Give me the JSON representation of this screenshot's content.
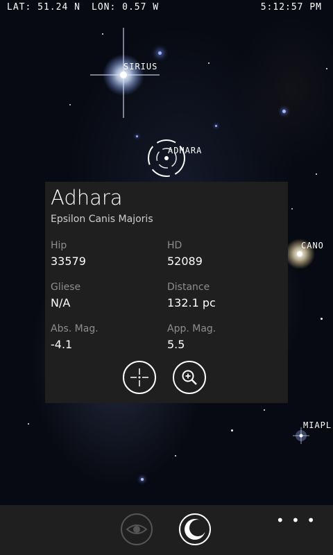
{
  "status": {
    "lat": "Lat: 51.24 N",
    "lon": "Lon: 0.57 W",
    "time": "5:12:57 PM"
  },
  "sky_labels": {
    "sirius": "Sirius",
    "adhara": "Adhara",
    "canopus": "Cano",
    "miaplacidus": "Miapl"
  },
  "card": {
    "name": "Adhara",
    "designation": "Epsilon Canis Majoris",
    "fields": [
      {
        "label": "Hip",
        "value": "33579"
      },
      {
        "label": "HD",
        "value": "52089"
      },
      {
        "label": "Gliese",
        "value": "N/A"
      },
      {
        "label": "Distance",
        "value": "132.1 pc"
      },
      {
        "label": "Abs. Mag.",
        "value": "-4.1"
      },
      {
        "label": "App. Mag.",
        "value": "5.5"
      }
    ],
    "icons": [
      "center-on-star-icon",
      "zoom-in-icon"
    ]
  },
  "app_bar": {
    "icons": [
      "eye-icon",
      "night-mode-icon"
    ],
    "more": "• • •"
  },
  "colors": {
    "card_bg": "#1f1f1f",
    "app_bar_bg": "#1f1f1f",
    "sky_bg": "#070a12"
  }
}
